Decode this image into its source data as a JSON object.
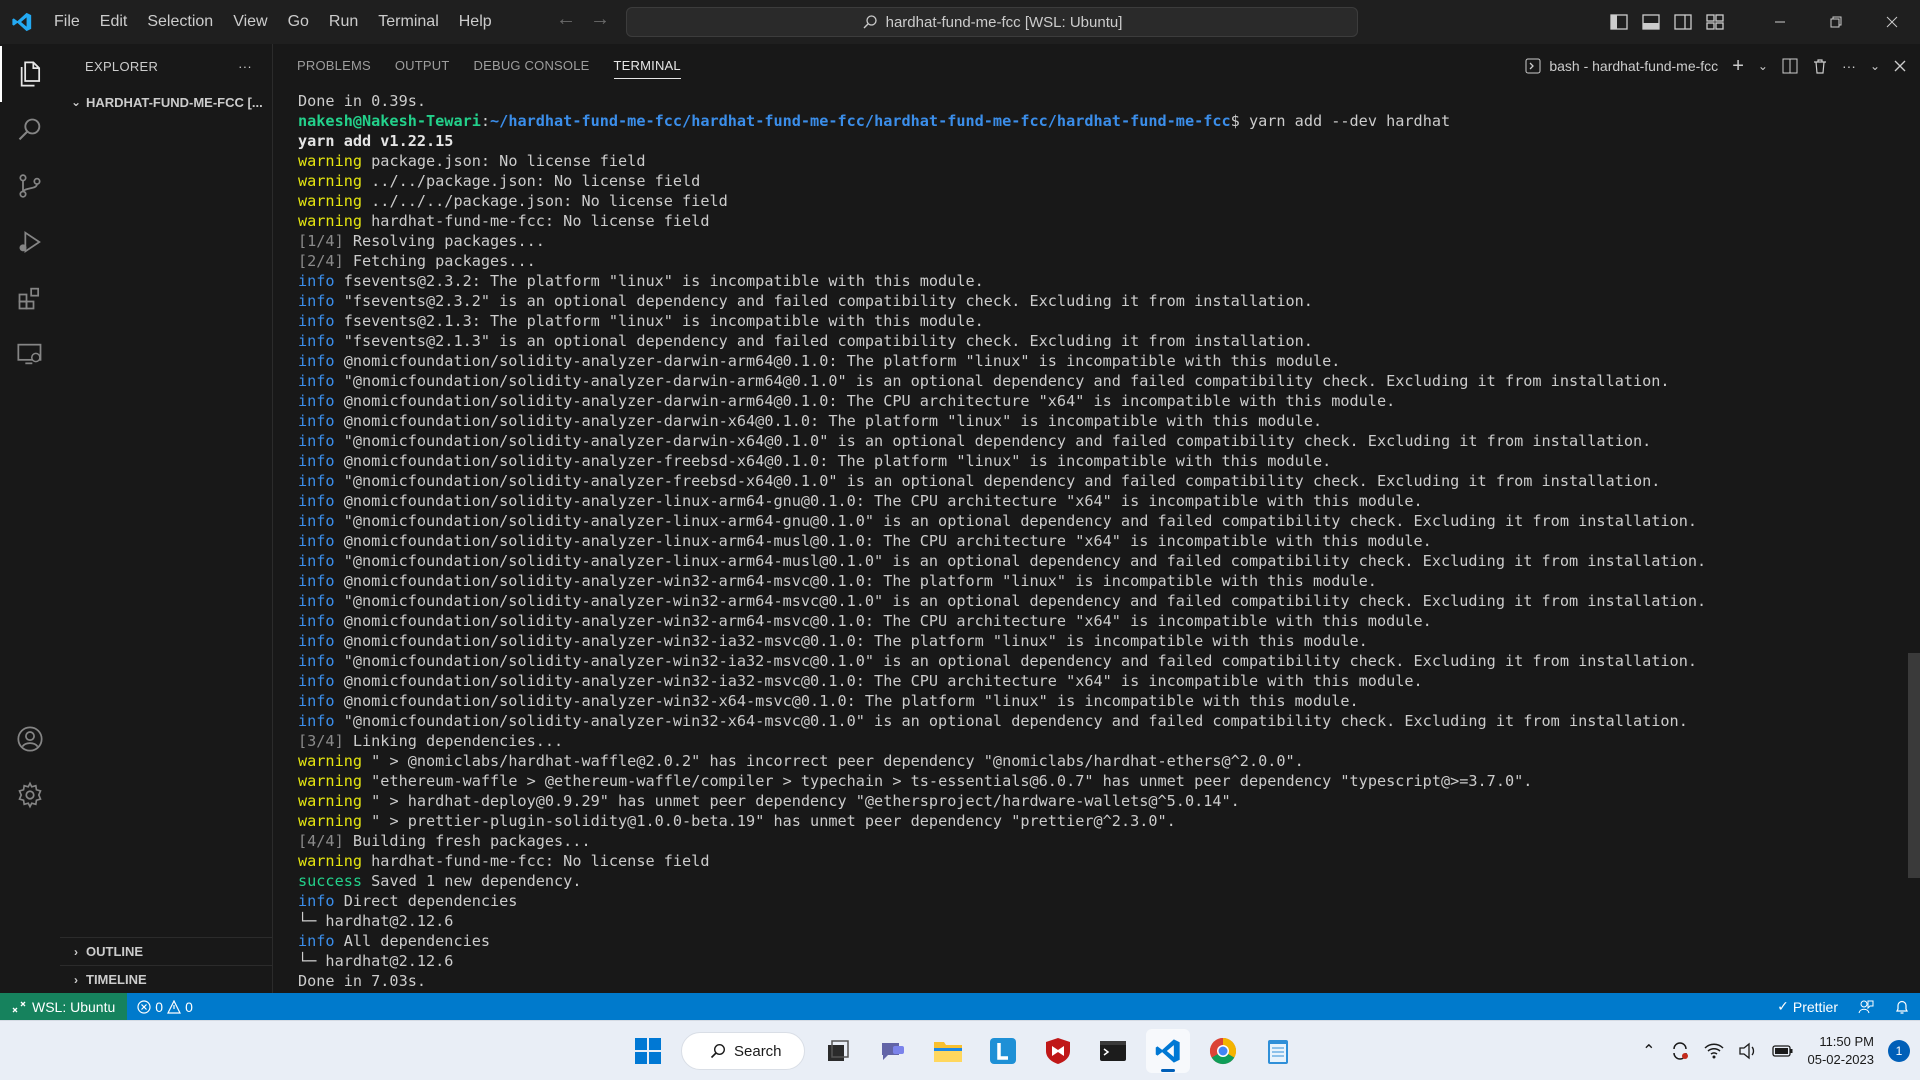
{
  "titlebar": {
    "menu": [
      "File",
      "Edit",
      "Selection",
      "View",
      "Go",
      "Run",
      "Terminal",
      "Help"
    ],
    "command_center": "hardhat-fund-me-fcc [WSL: Ubuntu]"
  },
  "sidebar": {
    "header": "EXPLORER",
    "more": "···",
    "folder": "HARDHAT-FUND-ME-FCC [...",
    "outline": "OUTLINE",
    "timeline": "TIMELINE"
  },
  "panel": {
    "tabs": [
      "PROBLEMS",
      "OUTPUT",
      "DEBUG CONSOLE",
      "TERMINAL"
    ],
    "active_tab": "TERMINAL",
    "terminal_name": "bash - hardhat-fund-me-fcc"
  },
  "terminal": {
    "lines": [
      [
        {
          "t": "Done in 0.39s."
        }
      ],
      [
        {
          "t": "nakesh@Nakesh-Tewari",
          "c": "user"
        },
        {
          "t": ":"
        },
        {
          "t": "~/hardhat-fund-me-fcc/hardhat-fund-me-fcc/hardhat-fund-me-fcc/hardhat-fund-me-fcc",
          "c": "path"
        },
        {
          "t": "$ yarn add --dev hardhat"
        }
      ],
      [
        {
          "t": "yarn add v1.22.15",
          "c": "bold"
        }
      ],
      [
        {
          "t": "warning",
          "c": "warn"
        },
        {
          "t": " package.json: No license field"
        }
      ],
      [
        {
          "t": "warning",
          "c": "warn"
        },
        {
          "t": " ../../package.json: No license field"
        }
      ],
      [
        {
          "t": "warning",
          "c": "warn"
        },
        {
          "t": " ../../../package.json: No license field"
        }
      ],
      [
        {
          "t": "warning",
          "c": "warn"
        },
        {
          "t": " hardhat-fund-me-fcc: No license field"
        }
      ],
      [
        {
          "t": "[1/4]",
          "c": "dim"
        },
        {
          "t": " Resolving packages..."
        }
      ],
      [
        {
          "t": "[2/4]",
          "c": "dim"
        },
        {
          "t": " Fetching packages..."
        }
      ],
      [
        {
          "t": "info",
          "c": "info"
        },
        {
          "t": " fsevents@2.3.2: The platform \"linux\" is incompatible with this module."
        }
      ],
      [
        {
          "t": "info",
          "c": "info"
        },
        {
          "t": " \"fsevents@2.3.2\" is an optional dependency and failed compatibility check. Excluding it from installation."
        }
      ],
      [
        {
          "t": "info",
          "c": "info"
        },
        {
          "t": " fsevents@2.1.3: The platform \"linux\" is incompatible with this module."
        }
      ],
      [
        {
          "t": "info",
          "c": "info"
        },
        {
          "t": " \"fsevents@2.1.3\" is an optional dependency and failed compatibility check. Excluding it from installation."
        }
      ],
      [
        {
          "t": "info",
          "c": "info"
        },
        {
          "t": " @nomicfoundation/solidity-analyzer-darwin-arm64@0.1.0: The platform \"linux\" is incompatible with this module."
        }
      ],
      [
        {
          "t": "info",
          "c": "info"
        },
        {
          "t": " \"@nomicfoundation/solidity-analyzer-darwin-arm64@0.1.0\" is an optional dependency and failed compatibility check. Excluding it from installation."
        }
      ],
      [
        {
          "t": "info",
          "c": "info"
        },
        {
          "t": " @nomicfoundation/solidity-analyzer-darwin-arm64@0.1.0: The CPU architecture \"x64\" is incompatible with this module."
        }
      ],
      [
        {
          "t": "info",
          "c": "info"
        },
        {
          "t": " @nomicfoundation/solidity-analyzer-darwin-x64@0.1.0: The platform \"linux\" is incompatible with this module."
        }
      ],
      [
        {
          "t": "info",
          "c": "info"
        },
        {
          "t": " \"@nomicfoundation/solidity-analyzer-darwin-x64@0.1.0\" is an optional dependency and failed compatibility check. Excluding it from installation."
        }
      ],
      [
        {
          "t": "info",
          "c": "info"
        },
        {
          "t": " @nomicfoundation/solidity-analyzer-freebsd-x64@0.1.0: The platform \"linux\" is incompatible with this module."
        }
      ],
      [
        {
          "t": "info",
          "c": "info"
        },
        {
          "t": " \"@nomicfoundation/solidity-analyzer-freebsd-x64@0.1.0\" is an optional dependency and failed compatibility check. Excluding it from installation."
        }
      ],
      [
        {
          "t": "info",
          "c": "info"
        },
        {
          "t": " @nomicfoundation/solidity-analyzer-linux-arm64-gnu@0.1.0: The CPU architecture \"x64\" is incompatible with this module."
        }
      ],
      [
        {
          "t": "info",
          "c": "info"
        },
        {
          "t": " \"@nomicfoundation/solidity-analyzer-linux-arm64-gnu@0.1.0\" is an optional dependency and failed compatibility check. Excluding it from installation."
        }
      ],
      [
        {
          "t": "info",
          "c": "info"
        },
        {
          "t": " @nomicfoundation/solidity-analyzer-linux-arm64-musl@0.1.0: The CPU architecture \"x64\" is incompatible with this module."
        }
      ],
      [
        {
          "t": "info",
          "c": "info"
        },
        {
          "t": " \"@nomicfoundation/solidity-analyzer-linux-arm64-musl@0.1.0\" is an optional dependency and failed compatibility check. Excluding it from installation."
        }
      ],
      [
        {
          "t": "info",
          "c": "info"
        },
        {
          "t": " @nomicfoundation/solidity-analyzer-win32-arm64-msvc@0.1.0: The platform \"linux\" is incompatible with this module."
        }
      ],
      [
        {
          "t": "info",
          "c": "info"
        },
        {
          "t": " \"@nomicfoundation/solidity-analyzer-win32-arm64-msvc@0.1.0\" is an optional dependency and failed compatibility check. Excluding it from installation."
        }
      ],
      [
        {
          "t": "info",
          "c": "info"
        },
        {
          "t": " @nomicfoundation/solidity-analyzer-win32-arm64-msvc@0.1.0: The CPU architecture \"x64\" is incompatible with this module."
        }
      ],
      [
        {
          "t": "info",
          "c": "info"
        },
        {
          "t": " @nomicfoundation/solidity-analyzer-win32-ia32-msvc@0.1.0: The platform \"linux\" is incompatible with this module."
        }
      ],
      [
        {
          "t": "info",
          "c": "info"
        },
        {
          "t": " \"@nomicfoundation/solidity-analyzer-win32-ia32-msvc@0.1.0\" is an optional dependency and failed compatibility check. Excluding it from installation."
        }
      ],
      [
        {
          "t": "info",
          "c": "info"
        },
        {
          "t": " @nomicfoundation/solidity-analyzer-win32-ia32-msvc@0.1.0: The CPU architecture \"x64\" is incompatible with this module."
        }
      ],
      [
        {
          "t": "info",
          "c": "info"
        },
        {
          "t": " @nomicfoundation/solidity-analyzer-win32-x64-msvc@0.1.0: The platform \"linux\" is incompatible with this module."
        }
      ],
      [
        {
          "t": "info",
          "c": "info"
        },
        {
          "t": " \"@nomicfoundation/solidity-analyzer-win32-x64-msvc@0.1.0\" is an optional dependency and failed compatibility check. Excluding it from installation."
        }
      ],
      [
        {
          "t": "[3/4]",
          "c": "dim"
        },
        {
          "t": " Linking dependencies..."
        }
      ],
      [
        {
          "t": "warning",
          "c": "warn"
        },
        {
          "t": " \" > @nomiclabs/hardhat-waffle@2.0.2\" has incorrect peer dependency \"@nomiclabs/hardhat-ethers@^2.0.0\"."
        }
      ],
      [
        {
          "t": "warning",
          "c": "warn"
        },
        {
          "t": " \"ethereum-waffle > @ethereum-waffle/compiler > typechain > ts-essentials@6.0.7\" has unmet peer dependency \"typescript@>=3.7.0\"."
        }
      ],
      [
        {
          "t": "warning",
          "c": "warn"
        },
        {
          "t": " \" > hardhat-deploy@0.9.29\" has unmet peer dependency \"@ethersproject/hardware-wallets@^5.0.14\"."
        }
      ],
      [
        {
          "t": "warning",
          "c": "warn"
        },
        {
          "t": " \" > prettier-plugin-solidity@1.0.0-beta.19\" has unmet peer dependency \"prettier@^2.3.0\"."
        }
      ],
      [
        {
          "t": "[4/4]",
          "c": "dim"
        },
        {
          "t": " Building fresh packages..."
        }
      ],
      [
        {
          "t": "warning",
          "c": "warn"
        },
        {
          "t": " hardhat-fund-me-fcc: No license field"
        }
      ],
      [
        {
          "t": "success",
          "c": "succ"
        },
        {
          "t": " Saved 1 new dependency."
        }
      ],
      [
        {
          "t": "info",
          "c": "info"
        },
        {
          "t": " Direct dependencies"
        }
      ],
      [
        {
          "t": "└─ hardhat@2.12.6"
        }
      ],
      [
        {
          "t": "info",
          "c": "info"
        },
        {
          "t": " All dependencies"
        }
      ],
      [
        {
          "t": "└─ hardhat@2.12.6"
        }
      ],
      [
        {
          "t": "Done in 7.03s."
        }
      ]
    ]
  },
  "statusbar": {
    "remote": "WSL: Ubuntu",
    "errors": "0",
    "warnings": "0",
    "prettier": "Prettier"
  },
  "taskbar": {
    "search": "Search",
    "time": "11:50 PM",
    "date": "05-02-2023",
    "notifications": "1"
  },
  "colors": {
    "accent": "#007acc",
    "remote": "#16825d",
    "warning": "#e5e510",
    "info": "#3b8eea",
    "success": "#23d18b"
  }
}
